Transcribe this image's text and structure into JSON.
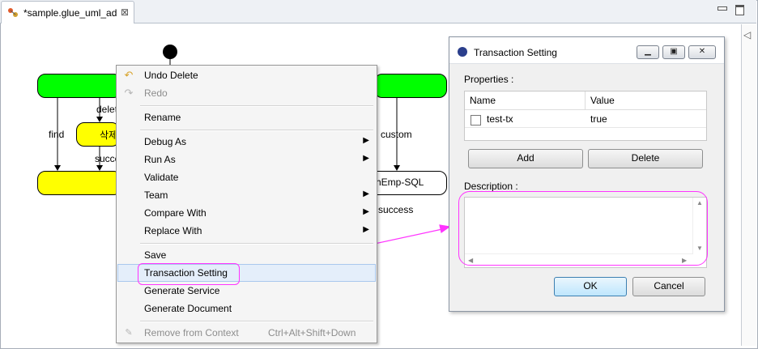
{
  "editor": {
    "tab_label": "*sample.glue_uml_ad",
    "tab_close": "⊠",
    "collapse_arrow": "◁"
  },
  "diagram": {
    "labels": {
      "delete": "delet",
      "find": "find",
      "korean": "삭제",
      "success_left": "succe",
      "custom": "custom",
      "box_text": "hEmp-SQL",
      "success_right": "success"
    }
  },
  "context_menu": {
    "items": [
      {
        "label": "Undo Delete",
        "icon": "undo-icon",
        "enabled": true
      },
      {
        "label": "Redo",
        "icon": "redo-icon",
        "enabled": false
      },
      {
        "label": "Rename",
        "enabled": true
      },
      {
        "label": "Debug As",
        "enabled": true,
        "submenu": true
      },
      {
        "label": "Run As",
        "enabled": true,
        "submenu": true
      },
      {
        "label": "Validate",
        "enabled": true
      },
      {
        "label": "Team",
        "enabled": true,
        "submenu": true
      },
      {
        "label": "Compare With",
        "enabled": true,
        "submenu": true
      },
      {
        "label": "Replace With",
        "enabled": true,
        "submenu": true
      },
      {
        "label": "Save",
        "enabled": true
      },
      {
        "label": "Transaction Setting",
        "enabled": true,
        "highlighted": true
      },
      {
        "label": "Generate Service",
        "enabled": true
      },
      {
        "label": "Generate Document",
        "enabled": true
      },
      {
        "label": "Remove from Context",
        "icon": "remove-context-icon",
        "enabled": false,
        "accelerator": "Ctrl+Alt+Shift+Down"
      }
    ],
    "submenu_arrow": "▶"
  },
  "dialog": {
    "title": "Transaction Setting",
    "properties_label": "Properties :",
    "columns": [
      "Name",
      "Value"
    ],
    "rows": [
      {
        "name": "test-tx",
        "value": "true",
        "checked": false
      }
    ],
    "add_label": "Add",
    "delete_label": "Delete",
    "description_label": "Description :",
    "description_value": "",
    "ok_label": "OK",
    "cancel_label": "Cancel"
  },
  "colors": {
    "accent_magenta": "#ff33ff",
    "state_green": "#00ff00",
    "state_yellow": "#ffff00"
  }
}
